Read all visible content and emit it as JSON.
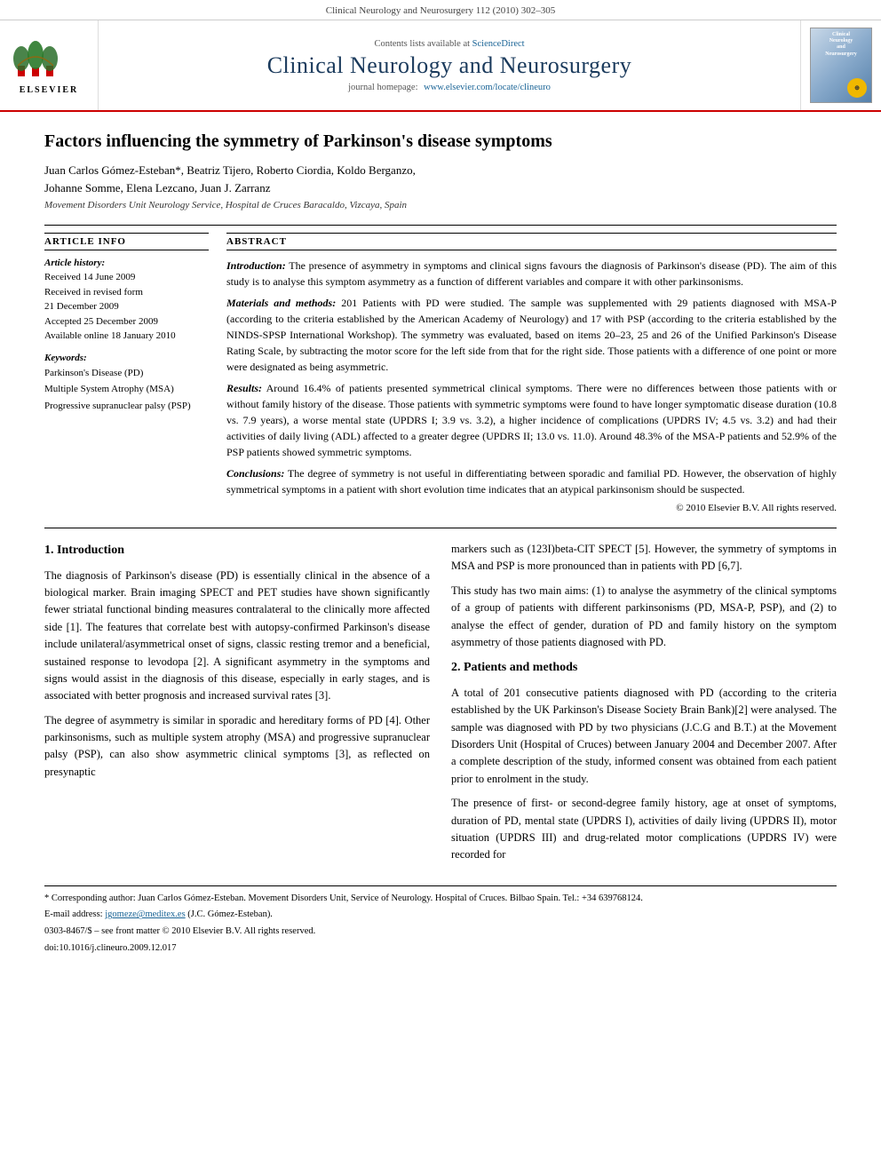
{
  "journal": {
    "top_citation": "Clinical Neurology and Neurosurgery 112 (2010) 302–305",
    "contents_line": "Contents lists available at",
    "contents_link_text": "ScienceDirect",
    "title": "Clinical Neurology and Neurosurgery",
    "homepage_label": "journal homepage:",
    "homepage_url": "www.elsevier.com/locate/clineuro",
    "elsevier_text": "ELSEVIER",
    "thumb_title": "Clinical\nNeurology\nand\nNeurosurgery",
    "badge_label": "⊕"
  },
  "article": {
    "title": "Factors influencing the symmetry of Parkinson's disease symptoms",
    "authors": "Juan Carlos Gómez-Esteban*, Beatriz Tijero, Roberto Ciordia, Koldo Berganzo,\nJohanne Somme, Elena Lezcano, Juan J. Zarranz",
    "affiliation": "Movement Disorders Unit Neurology Service, Hospital de Cruces Baracaldo, Vizcaya, Spain"
  },
  "article_info": {
    "section_heading": "ARTICLE INFO",
    "history_label": "Article history:",
    "received": "Received 14 June 2009",
    "received_revised": "Received in revised form\n21 December 2009",
    "accepted": "Accepted 25 December 2009",
    "available": "Available online 18 January 2010",
    "keywords_label": "Keywords:",
    "keywords": [
      "Parkinson's Disease (PD)",
      "Multiple System Atrophy (MSA)",
      "Progressive supranuclear palsy (PSP)"
    ]
  },
  "abstract": {
    "section_heading": "ABSTRACT",
    "intro_label": "Introduction:",
    "intro_text": "The presence of asymmetry in symptoms and clinical signs favours the diagnosis of Parkinson's disease (PD). The aim of this study is to analyse this symptom asymmetry as a function of different variables and compare it with other parkinsonisms.",
    "methods_label": "Materials and methods:",
    "methods_text": "201 Patients with PD were studied. The sample was supplemented with 29 patients diagnosed with MSA-P (according to the criteria established by the American Academy of Neurology) and 17 with PSP (according to the criteria established by the NINDS-SPSP International Workshop). The symmetry was evaluated, based on items 20–23, 25 and 26 of the Unified Parkinson's Disease Rating Scale, by subtracting the motor score for the left side from that for the right side. Those patients with a difference of one point or more were designated as being asymmetric.",
    "results_label": "Results:",
    "results_text": "Around 16.4% of patients presented symmetrical clinical symptoms. There were no differences between those patients with or without family history of the disease. Those patients with symmetric symptoms were found to have longer symptomatic disease duration (10.8 vs. 7.9 years), a worse mental state (UPDRS I; 3.9 vs. 3.2), a higher incidence of complications (UPDRS IV; 4.5 vs. 3.2) and had their activities of daily living (ADL) affected to a greater degree (UPDRS II; 13.0 vs. 11.0). Around 48.3% of the MSA-P patients and 52.9% of the PSP patients showed symmetric symptoms.",
    "conclusions_label": "Conclusions:",
    "conclusions_text": "The degree of symmetry is not useful in differentiating between sporadic and familial PD. However, the observation of highly symmetrical symptoms in a patient with short evolution time indicates that an atypical parkinsonism should be suspected.",
    "copyright": "© 2010 Elsevier B.V. All rights reserved."
  },
  "body": {
    "section1_title": "1.  Introduction",
    "para1": "The diagnosis of Parkinson's disease (PD) is essentially clinical in the absence of a biological marker. Brain imaging SPECT and PET studies have shown significantly fewer striatal functional binding measures contralateral to the clinically more affected side [1]. The features that correlate best with autopsy-confirmed Parkinson's disease include unilateral/asymmetrical onset of signs, classic resting tremor and a beneficial, sustained response to levodopa [2]. A significant asymmetry in the symptoms and signs would assist in the diagnosis of this disease, especially in early stages, and is associated with better prognosis and increased survival rates [3].",
    "para2": "The degree of asymmetry is similar in sporadic and hereditary forms of PD [4]. Other parkinsonisms, such as multiple system atrophy (MSA) and progressive supranuclear palsy (PSP), can also show asymmetric clinical symptoms [3], as reflected on presynaptic",
    "right_para1": "markers such as (123I)beta-CIT SPECT [5]. However, the symmetry of symptoms in MSA and PSP is more pronounced than in patients with PD [6,7].",
    "right_para2": "This study has two main aims: (1) to analyse the asymmetry of the clinical symptoms of a group of patients with different parkinsonisms (PD, MSA-P, PSP), and (2) to analyse the effect of gender, duration of PD and family history on the symptom asymmetry of those patients diagnosed with PD.",
    "section2_title": "2.  Patients and methods",
    "right_para3": "A total of 201 consecutive patients diagnosed with PD (according to the criteria established by the UK Parkinson's Disease Society Brain Bank)[2] were analysed. The sample was diagnosed with PD by two physicians (J.C.G and B.T.) at the Movement Disorders Unit (Hospital of Cruces) between January 2004 and December 2007. After a complete description of the study, informed consent was obtained from each patient prior to enrolment in the study.",
    "right_para4": "The presence of first- or second-degree family history, age at onset of symptoms, duration of PD, mental state (UPDRS I), activities of daily living (UPDRS II), motor situation (UPDRS III) and drug-related motor complications (UPDRS IV) were recorded for"
  },
  "footnotes": {
    "corresponding": "* Corresponding author: Juan Carlos Gómez-Esteban. Movement Disorders Unit, Service of Neurology. Hospital of Cruces. Bilbao Spain. Tel.: +34 639768124.",
    "email_label": "E-mail address:",
    "email": "jgomeze@meditex.es",
    "email_suffix": "(J.C. Gómez-Esteban).",
    "issn": "0303-8467/$ – see front matter © 2010 Elsevier B.V. All rights reserved.",
    "doi": "doi:10.1016/j.clineuro.2009.12.017"
  }
}
